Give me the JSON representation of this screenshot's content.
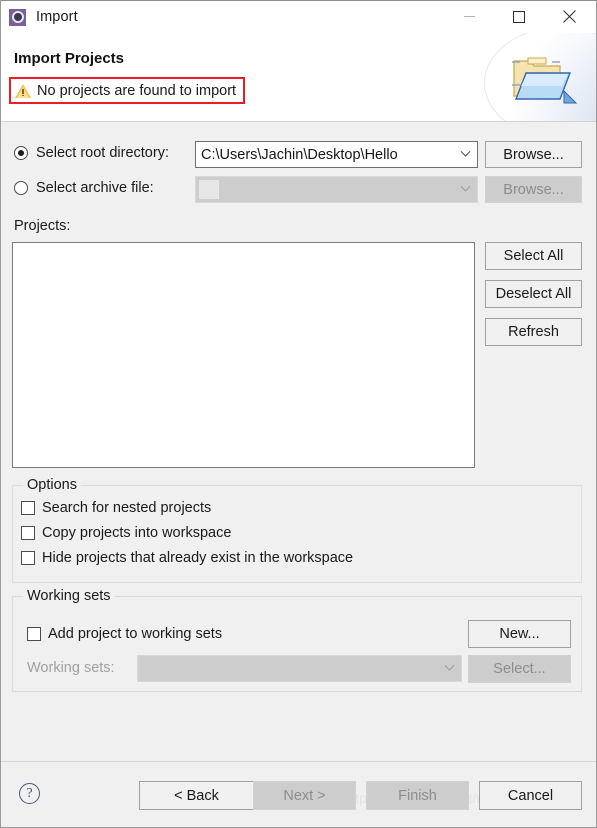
{
  "window": {
    "title": "Import",
    "icon": "eclipse-import-icon",
    "controls": {
      "minimize": "minimize-icon",
      "maximize": "maximize-icon",
      "close": "close-icon"
    }
  },
  "header": {
    "title": "Import Projects",
    "message": "No projects are found to import",
    "message_icon": "warning-icon",
    "message_highlight_color": "#ee1c23",
    "banner_icon": "folder-import-icon"
  },
  "source": {
    "root_directory": {
      "label": "Select root directory:",
      "selected": true,
      "value": "C:\\Users\\Jachin\\Desktop\\Hello",
      "browse_label": "Browse...",
      "browse_enabled": true
    },
    "archive_file": {
      "label": "Select archive file:",
      "selected": false,
      "value": "",
      "browse_label": "Browse...",
      "browse_enabled": false
    }
  },
  "projects": {
    "label": "Projects:",
    "items": [],
    "buttons": [
      {
        "label": "Select All",
        "enabled": true
      },
      {
        "label": "Deselect All",
        "enabled": true
      },
      {
        "label": "Refresh",
        "enabled": true
      }
    ]
  },
  "options": {
    "legend": "Options",
    "checkboxes": [
      {
        "label": "Search for nested projects",
        "checked": false
      },
      {
        "label": "Copy projects into workspace",
        "checked": false
      },
      {
        "label": "Hide projects that already exist in the workspace",
        "checked": false
      }
    ]
  },
  "working_sets": {
    "legend": "Working sets",
    "add_checkbox": {
      "label": "Add project to working sets",
      "checked": false
    },
    "new_button": {
      "label": "New...",
      "enabled": true
    },
    "combo_label": "Working sets:",
    "combo_value": "",
    "combo_enabled": false,
    "select_button": {
      "label": "Select...",
      "enabled": false
    }
  },
  "footer": {
    "help_icon": "help-icon",
    "buttons": [
      {
        "label": "< Back",
        "enabled": true
      },
      {
        "label": "Next >",
        "enabled": false
      },
      {
        "label": "Finish",
        "enabled": false
      },
      {
        "label": "Cancel",
        "enabled": true
      }
    ],
    "watermark": "https://blog.csdn.net/m0_46132054"
  }
}
